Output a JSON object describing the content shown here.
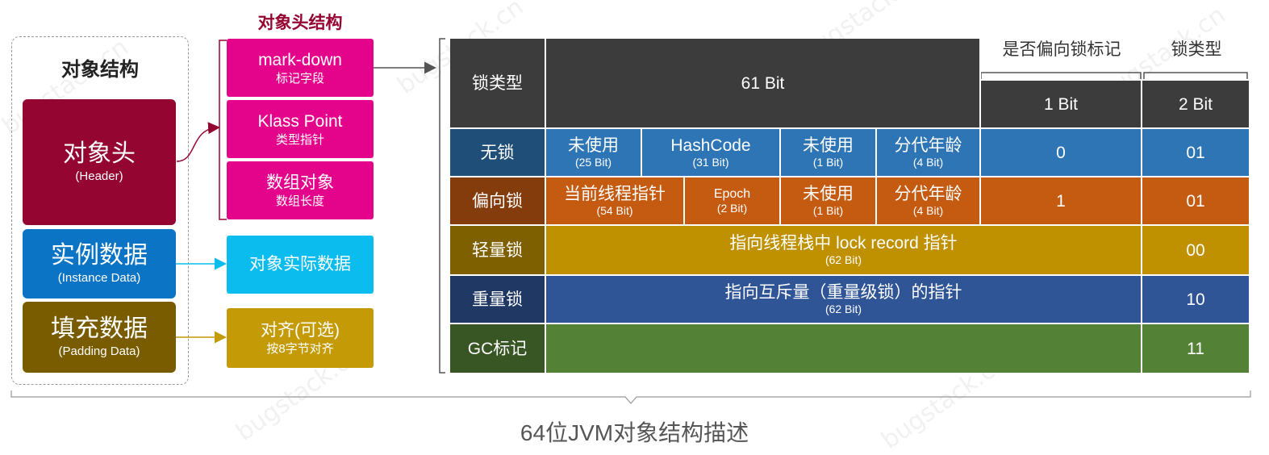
{
  "object_structure": {
    "title": "对象结构",
    "header": {
      "label": "对象头",
      "sub": "(Header)"
    },
    "instance": {
      "label": "实例数据",
      "sub": "(Instance Data)"
    },
    "padding": {
      "label": "填充数据",
      "sub": "(Padding Data)"
    }
  },
  "header_structure": {
    "title": "对象头结构",
    "mark": {
      "label": "mark-down",
      "sub": "标记字段"
    },
    "klass": {
      "label": "Klass Point",
      "sub": "类型指针"
    },
    "array": {
      "label": "数组对象",
      "sub": "数组长度"
    }
  },
  "instance_box": {
    "label": "对象实际数据"
  },
  "padding_box": {
    "label": "对齐(可选)",
    "sub": "按8字节对齐"
  },
  "table": {
    "above_labels": {
      "biased_flag": "是否偏向锁标记",
      "lock_type": "锁类型"
    },
    "header": {
      "lock_type": "锁类型",
      "bits61": "61 Bit",
      "bit1": "1 Bit",
      "bit2": "2 Bit"
    },
    "rows": {
      "nolock": {
        "name": "无锁",
        "c1": {
          "t": "未使用",
          "s": "(25 Bit)"
        },
        "c2": {
          "t": "HashCode",
          "s": "(31 Bit)"
        },
        "c3": {
          "t": "未使用",
          "s": "(1 Bit)"
        },
        "c4": {
          "t": "分代年龄",
          "s": "(4 Bit)"
        },
        "flag": "0",
        "type": "01"
      },
      "biased": {
        "name": "偏向锁",
        "c1": {
          "t": "当前线程指针",
          "s": "(54 Bit)"
        },
        "c2": {
          "t": "Epoch",
          "s": "(2 Bit)"
        },
        "c3": {
          "t": "未使用",
          "s": "(1 Bit)"
        },
        "c4": {
          "t": "分代年龄",
          "s": "(4 Bit)"
        },
        "flag": "1",
        "type": "01"
      },
      "light": {
        "name": "轻量锁",
        "t": "指向线程栈中 lock record 指针",
        "s": "(62 Bit)",
        "type": "00"
      },
      "heavy": {
        "name": "重量锁",
        "t": "指向互斥量（重量级锁）的指针",
        "s": "(62 Bit)",
        "type": "10"
      },
      "gc": {
        "name": "GC标记",
        "type": "11"
      }
    }
  },
  "caption": "64位JVM对象结构描述",
  "colors": {
    "header_red": "#950532",
    "instance_blue": "#0b74c4",
    "padding_brown": "#7a5c00",
    "magenta": "#e4048b",
    "cyan": "#0bbcee",
    "gold": "#c49b06",
    "dark": "#3c3c3c",
    "row_blue": "#2e75b6",
    "row_blue_dark": "#1f4e79",
    "row_orange": "#c55a11",
    "row_orange_dark": "#843c0c",
    "row_gold": "#bf9000",
    "row_gold_dark": "#7f6000",
    "row_navy": "#2f5597",
    "row_navy_dark": "#203864",
    "row_green": "#538135",
    "row_green_dark": "#375623"
  }
}
